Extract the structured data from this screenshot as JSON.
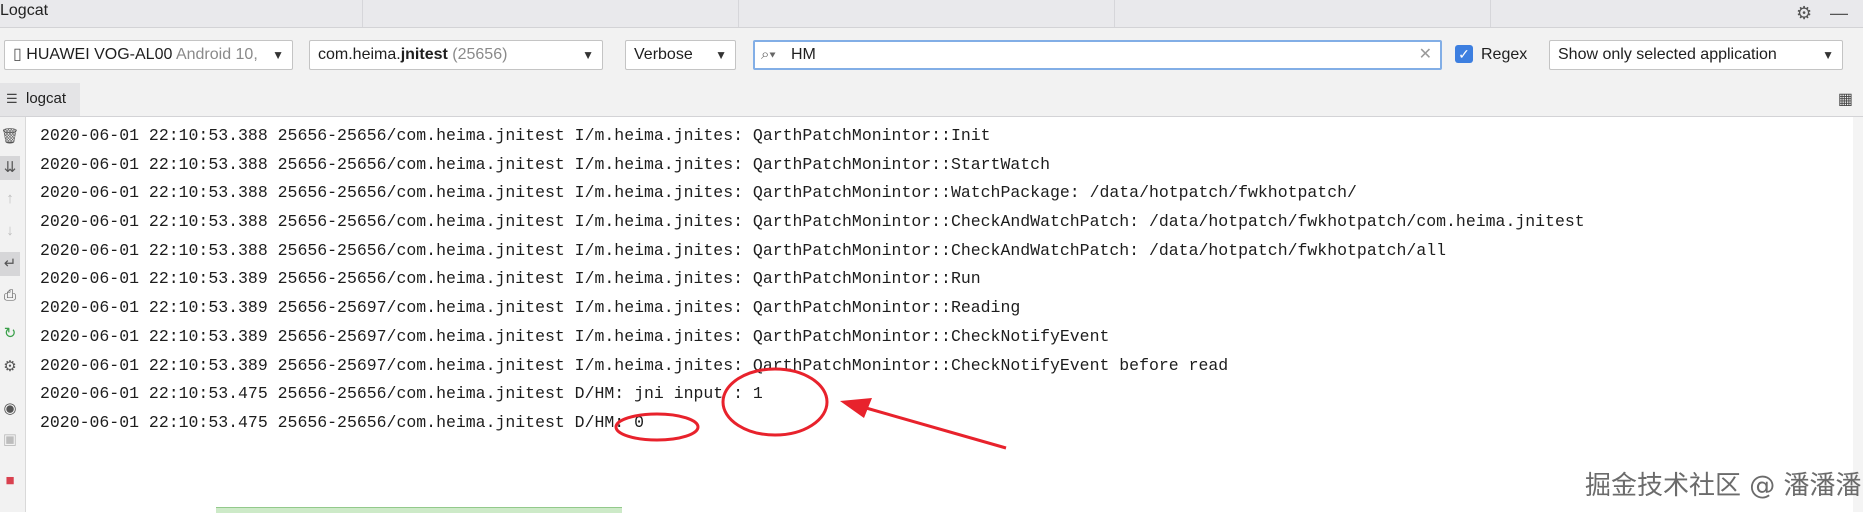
{
  "window": {
    "title": "Logcat"
  },
  "toolbar": {
    "device": {
      "name": "HUAWEI VOG-AL00",
      "detail": "Android 10,"
    },
    "process": {
      "package_prefix": "com.heima.",
      "package_name": "jnitest",
      "pid": "(25656)"
    },
    "level": "Verbose",
    "search": {
      "value": "HM"
    },
    "regex": {
      "label": "Regex",
      "checked": true
    },
    "filter": "Show only selected application"
  },
  "tabs": [
    {
      "label": "logcat"
    }
  ],
  "sidebar_icons": [
    "trash-icon",
    "scroll-to-end-icon",
    "up-arrow-icon",
    "down-arrow-icon",
    "soft-wrap-icon",
    "print-icon",
    "restart-icon",
    "settings-icon",
    "screenshot-icon",
    "screen-record-icon",
    "stop-icon"
  ],
  "log_lines": [
    "2020-06-01 22:10:53.388 25656-25656/com.heima.jnitest I/m.heima.jnites: QarthPatchMonintor::Init",
    "2020-06-01 22:10:53.388 25656-25656/com.heima.jnitest I/m.heima.jnites: QarthPatchMonintor::StartWatch",
    "2020-06-01 22:10:53.388 25656-25656/com.heima.jnitest I/m.heima.jnites: QarthPatchMonintor::WatchPackage: /data/hotpatch/fwkhotpatch/",
    "2020-06-01 22:10:53.388 25656-25656/com.heima.jnitest I/m.heima.jnites: QarthPatchMonintor::CheckAndWatchPatch: /data/hotpatch/fwkhotpatch/com.heima.jnitest",
    "2020-06-01 22:10:53.388 25656-25656/com.heima.jnitest I/m.heima.jnites: QarthPatchMonintor::CheckAndWatchPatch: /data/hotpatch/fwkhotpatch/all",
    "2020-06-01 22:10:53.389 25656-25656/com.heima.jnitest I/m.heima.jnites: QarthPatchMonintor::Run",
    "2020-06-01 22:10:53.389 25656-25697/com.heima.jnitest I/m.heima.jnites: QarthPatchMonintor::Reading",
    "2020-06-01 22:10:53.389 25656-25697/com.heima.jnitest I/m.heima.jnites: QarthPatchMonintor::CheckNotifyEvent",
    "2020-06-01 22:10:53.389 25656-25697/com.heima.jnitest I/m.heima.jnites: QarthPatchMonintor::CheckNotifyEvent before read",
    "2020-06-01 22:10:53.475 25656-25656/com.heima.jnitest D/HM: jni input : 1",
    "2020-06-01 22:10:53.475 25656-25656/com.heima.jnitest D/HM: 0"
  ],
  "watermark": "掘金技术社区 @ 潘潘潘",
  "colors": {
    "annotation": "#e8222c",
    "accent": "#3d7fe0",
    "search_border": "#82aee6"
  }
}
